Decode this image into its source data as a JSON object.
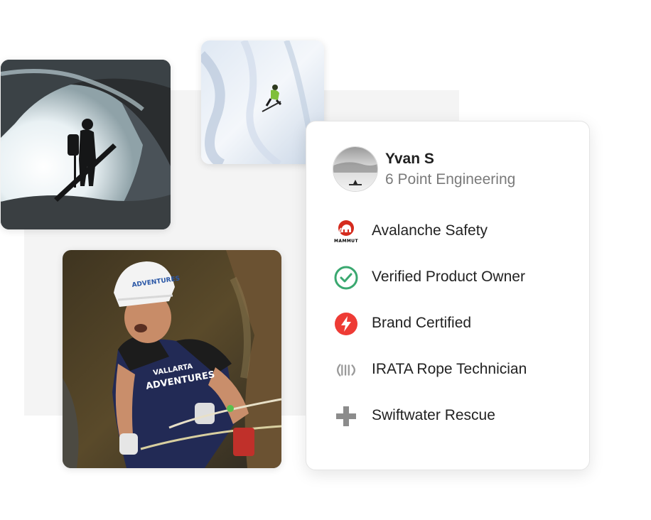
{
  "profile": {
    "name": "Yvan S",
    "company": "6 Point Engineering"
  },
  "badges": [
    {
      "label": "Avalanche Safety",
      "icon": "mammut-logo",
      "color": "#d52b1e",
      "logo_text": "MAMMUT"
    },
    {
      "label": "Verified Product Owner",
      "icon": "check-circle-icon",
      "color": "#3aa870"
    },
    {
      "label": "Brand Certified",
      "icon": "lightning-bolt-icon",
      "color": "#ee3b35"
    },
    {
      "label": "IRATA Rope Technician",
      "icon": "irata-logo",
      "color": "#9a9a9a"
    },
    {
      "label": "Swiftwater Rescue",
      "icon": "plus-icon",
      "color": "#8c8c8c"
    }
  ],
  "photos": [
    {
      "name": "ice-cave-photo",
      "subject": "skier silhouette in ice cave"
    },
    {
      "name": "skiing-photo",
      "subject": "skier descending snowy slope"
    },
    {
      "name": "canyoneering-photo",
      "subject": "rappelling guide in helmet"
    }
  ],
  "climber_photo_text": {
    "helmet": "ADVENTURES",
    "shirt_line1": "VALLARTA",
    "shirt_line2": "ADVENTURES"
  }
}
